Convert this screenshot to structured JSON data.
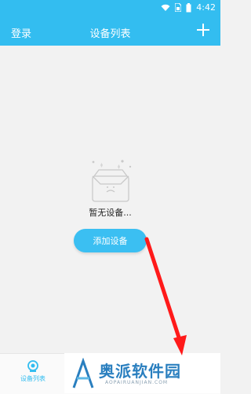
{
  "status_bar": {
    "time": "4:42",
    "icons": [
      "wifi-icon",
      "sim-icon",
      "battery-icon"
    ]
  },
  "app_bar": {
    "left_label": "登录",
    "title": "设备列表",
    "add_icon": "plus-icon"
  },
  "empty_state": {
    "icon": "empty-box-icon",
    "message": "暂无设备..."
  },
  "add_button": {
    "label": "添加设备"
  },
  "tab_bar": {
    "items": [
      {
        "label": "设备列表",
        "icon": "camera-icon",
        "active": true
      }
    ]
  },
  "watermark": {
    "brand": "奥派软件园",
    "brand_sub": "AOPAIRUANJIAN.COM"
  },
  "colors": {
    "primary": "#33bdf0",
    "arrow": "#ff1a1a",
    "brand": "#2a7fbf"
  }
}
